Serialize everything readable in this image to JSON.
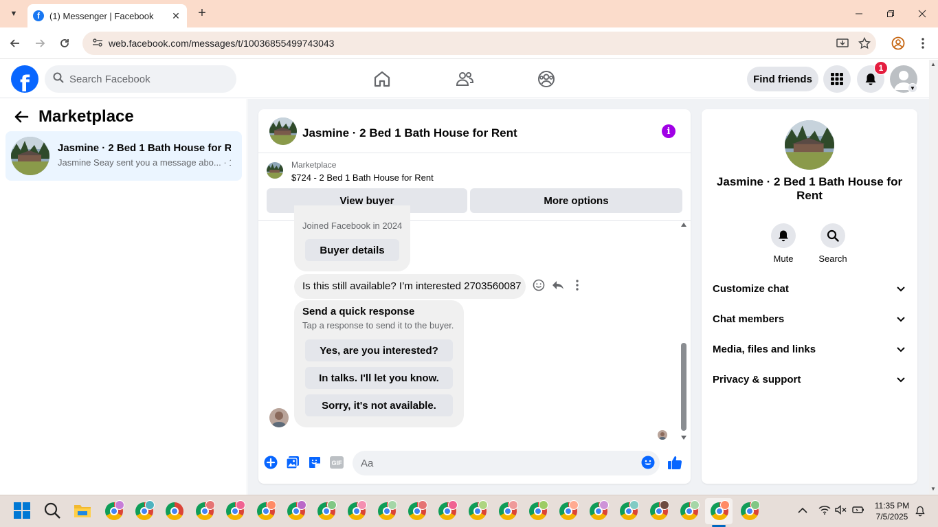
{
  "browser": {
    "tab_title": "(1) Messenger | Facebook",
    "url": "web.facebook.com/messages/t/10036855499743043"
  },
  "facebook": {
    "search_placeholder": "Search Facebook",
    "find_friends": "Find friends",
    "notification_count": "1"
  },
  "left": {
    "title": "Marketplace",
    "conversation": {
      "name": "Jasmine · 2 Bed 1 Bath House for R...",
      "preview": "Jasmine Seay sent you a message abo... · 1h"
    }
  },
  "chat": {
    "title": "Jasmine · 2 Bed 1 Bath House for Rent",
    "marketplace_label": "Marketplace",
    "listing": "$724 - 2 Bed 1 Bath House for Rent",
    "view_buyer": "View buyer",
    "more_options": "More options",
    "joined": "Joined Facebook in 2024",
    "buyer_details": "Buyer details",
    "message": "Is this still available? I’m interested 2703560087",
    "quick_response_title": "Send a quick response",
    "quick_response_sub": "Tap a response to send it to the buyer.",
    "quick_responses": [
      "Yes, are you interested?",
      "In talks. I'll let you know.",
      "Sorry, it's not available."
    ],
    "composer_placeholder": "Aa",
    "gif_label": "GIF"
  },
  "panel": {
    "title": "Jasmine · 2 Bed 1 Bath House for Rent",
    "mute": "Mute",
    "search": "Search",
    "sections": [
      "Customize chat",
      "Chat members",
      "Media, files and links",
      "Privacy & support"
    ]
  },
  "taskbar": {
    "time": "11:35 PM",
    "date": "7/5/2025"
  },
  "colors": {
    "facebook_blue": "#0866ff",
    "messenger_purple": "#a000e6",
    "notification_red": "#e41e3f",
    "tab_strip": "#fbdccb"
  }
}
